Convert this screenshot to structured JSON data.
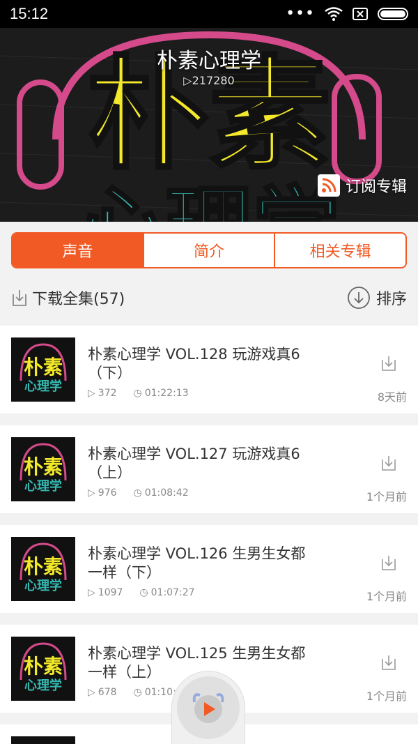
{
  "status_bar": {
    "time": "15:12",
    "dots": "•••"
  },
  "album": {
    "title": "朴素心理学",
    "plays": "217280",
    "subscribe_label": "订阅专辑"
  },
  "tabs": [
    {
      "label": "声音",
      "active": true
    },
    {
      "label": "简介",
      "active": false
    },
    {
      "label": "相关专辑",
      "active": false
    }
  ],
  "toolbar": {
    "download_all": "下载全集(57)",
    "sort": "排序"
  },
  "episodes": [
    {
      "title": "朴素心理学 VOL.128 玩游戏真6（下）",
      "plays": "372",
      "duration": "01:22:13",
      "time": "8天前"
    },
    {
      "title": "朴素心理学 VOL.127 玩游戏真6（上）",
      "plays": "976",
      "duration": "01:08:42",
      "time": "1个月前"
    },
    {
      "title": "朴素心理学 VOL.126 生男生女都一样（下）",
      "plays": "1097",
      "duration": "01:07:27",
      "time": "1个月前"
    },
    {
      "title": "朴素心理学 VOL.125 生男生女都一样（上）",
      "plays": "678",
      "duration": "01:10:1",
      "time": "1个月前"
    }
  ],
  "colors": {
    "accent": "#f15a24",
    "cover_yellow": "#f3e92a",
    "cover_cyan": "#34b8b0",
    "cover_pink": "#d44a8a"
  },
  "cover_text": {
    "line1": "朴素",
    "line2": "心理学"
  }
}
